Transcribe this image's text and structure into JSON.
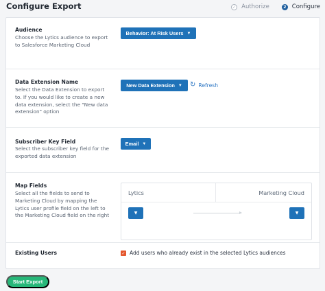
{
  "header": {
    "title": "Configure Export",
    "steps": [
      {
        "label": "Authorize",
        "state": "done"
      },
      {
        "label": "Configure",
        "state": "active",
        "number": "2"
      }
    ]
  },
  "sections": {
    "audience": {
      "title": "Audience",
      "description": "Choose the Lytics audience to export to Salesforce Marketing Cloud",
      "button_label": "Behavior: At Risk Users"
    },
    "data_extension": {
      "title": "Data Extension Name",
      "description": "Select the Data Extension to export to. If you would like to create a new data extension, select the \"New data extension\" option",
      "button_label": "New Data Extension",
      "refresh_label": "Refresh"
    },
    "subscriber_key": {
      "title": "Subscriber Key Field",
      "description": "Select the subscriber key field for the exported data extension",
      "button_label": "Email"
    },
    "map_fields": {
      "title": "Map Fields",
      "description": "Select all the fields to send to Marketing Cloud by mapping the Lytics user profile field on the left to the Marketing Cloud field on the right",
      "left_header": "Lytics",
      "right_header": "Marketing Cloud"
    },
    "existing_users": {
      "title": "Existing Users",
      "checkbox_label": "Add users who already exist in the selected Lytics audiences",
      "checked": true
    }
  },
  "footer": {
    "start_label": "Start Export"
  },
  "colors": {
    "primary": "#1f72b8",
    "success": "#27b779",
    "checkbox": "#e4572e",
    "link": "#2f78c4"
  }
}
